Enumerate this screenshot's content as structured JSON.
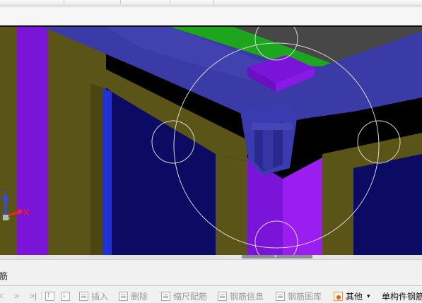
{
  "top_toolbar": {
    "buttons": [
      "",
      "",
      "",
      ""
    ]
  },
  "viewport": {
    "axes": {
      "z_label": "Z",
      "x_label": "X"
    },
    "colors": {
      "background": "#000000",
      "olive": "#5a5417",
      "olive_dark": "#4c4712",
      "violet": "#7a14d8",
      "violet_light": "#9b1ef0",
      "blue_beam": "#3a3aa8",
      "blue_beam_dark": "#2c2c8f",
      "navy": "#0b0b63",
      "green": "#1fa81f",
      "gray_slab": "#4a4a4a",
      "grip_circle": "#d8d8d8"
    }
  },
  "panel": {
    "title": "筋"
  },
  "bottom_toolbar": {
    "nav_first": "<",
    "nav_next": ">",
    "nav_last": ">|",
    "insert_label": "插入",
    "delete_label": "删除",
    "scale_label": "缩尺配筋",
    "info_label": "钢筋信息",
    "library_label": "钢筋图库",
    "other_label": "其他",
    "other_dropdown": "▾",
    "single_component_label": "单构件钢筋"
  }
}
